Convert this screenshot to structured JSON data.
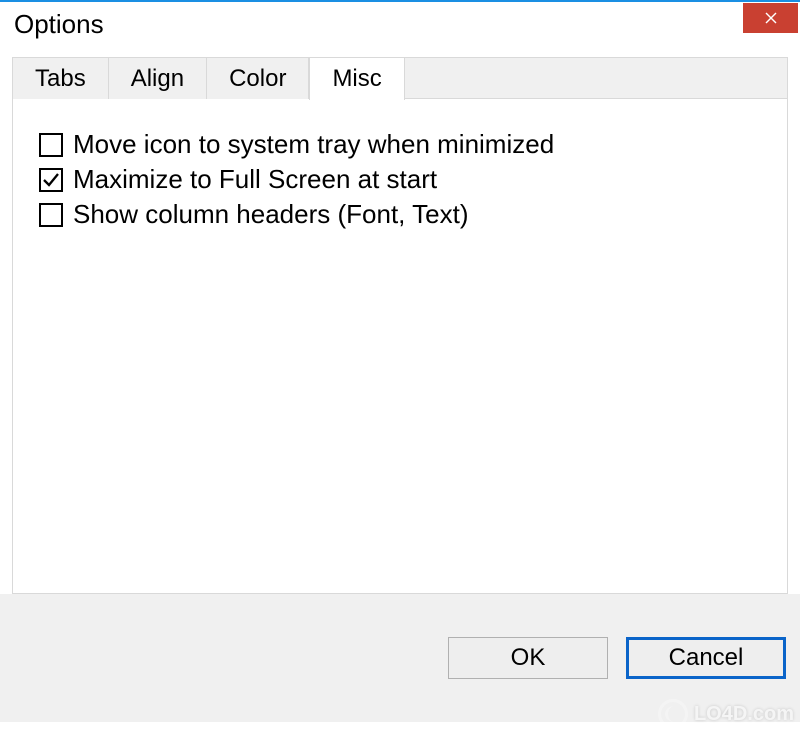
{
  "window": {
    "title": "Options"
  },
  "tabs": [
    {
      "label": "Tabs",
      "active": false
    },
    {
      "label": "Align",
      "active": false
    },
    {
      "label": "Color",
      "active": false
    },
    {
      "label": "Misc",
      "active": true
    }
  ],
  "options": {
    "move_tray": {
      "label": "Move icon to system tray when minimized",
      "checked": false
    },
    "maximize_start": {
      "label": "Maximize to Full Screen at start",
      "checked": true
    },
    "show_headers": {
      "label": "Show column headers (Font, Text)",
      "checked": false
    }
  },
  "buttons": {
    "ok": "OK",
    "cancel": "Cancel"
  },
  "watermark": "LO4D.com"
}
